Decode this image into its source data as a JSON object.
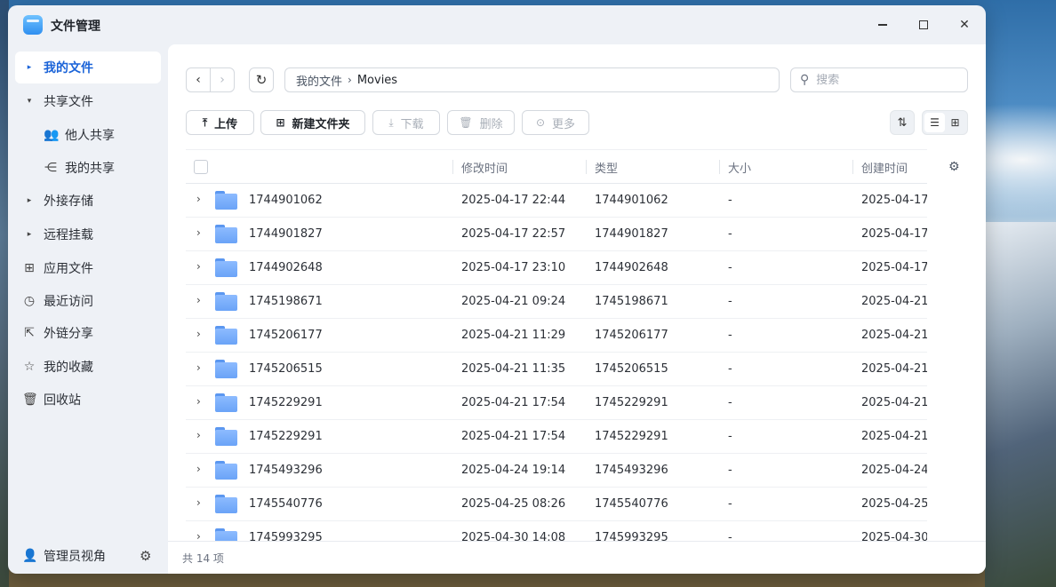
{
  "app": {
    "title": "文件管理"
  },
  "sidebar": {
    "items": [
      {
        "label": "我的文件",
        "caret": "▸",
        "active": true
      },
      {
        "label": "共享文件",
        "caret": "▾"
      },
      {
        "label": "他人共享",
        "icon": "users-icon"
      },
      {
        "label": "我的共享",
        "icon": "share-icon"
      },
      {
        "label": "外接存储",
        "caret": "▸"
      },
      {
        "label": "远程挂载",
        "caret": "▸"
      },
      {
        "label": "应用文件",
        "icon": "apps-icon"
      },
      {
        "label": "最近访问",
        "icon": "clock-icon"
      },
      {
        "label": "外链分享",
        "icon": "external-share-icon"
      },
      {
        "label": "我的收藏",
        "icon": "star-icon"
      },
      {
        "label": "回收站",
        "icon": "trash-icon"
      }
    ],
    "footer": {
      "label": "管理员视角",
      "icon": "admin-user-icon",
      "settings_icon": "gear-icon"
    }
  },
  "breadcrumb": {
    "root": "我的文件",
    "separator": "›",
    "current": "Movies"
  },
  "search": {
    "placeholder": "搜索"
  },
  "toolbar": {
    "upload": "上传",
    "new_folder": "新建文件夹",
    "download": "下载",
    "delete": "删除",
    "more": "更多"
  },
  "table": {
    "columns": {
      "modified": "修改时间",
      "type": "类型",
      "size": "大小",
      "created": "创建时间"
    },
    "rows": [
      {
        "name": "1744901062",
        "modified": "2025-04-17 22:44",
        "type": "1744901062",
        "size": "-",
        "created": "2025-04-17"
      },
      {
        "name": "1744901827",
        "modified": "2025-04-17 22:57",
        "type": "1744901827",
        "size": "-",
        "created": "2025-04-17"
      },
      {
        "name": "1744902648",
        "modified": "2025-04-17 23:10",
        "type": "1744902648",
        "size": "-",
        "created": "2025-04-17"
      },
      {
        "name": "1745198671",
        "modified": "2025-04-21 09:24",
        "type": "1745198671",
        "size": "-",
        "created": "2025-04-21"
      },
      {
        "name": "1745206177",
        "modified": "2025-04-21 11:29",
        "type": "1745206177",
        "size": "-",
        "created": "2025-04-21"
      },
      {
        "name": "1745206515",
        "modified": "2025-04-21 11:35",
        "type": "1745206515",
        "size": "-",
        "created": "2025-04-21"
      },
      {
        "name": "1745229291",
        "modified": "2025-04-21 17:54",
        "type": "1745229291",
        "size": "-",
        "created": "2025-04-21"
      },
      {
        "name": "1745229291",
        "modified": "2025-04-21 17:54",
        "type": "1745229291",
        "size": "-",
        "created": "2025-04-21"
      },
      {
        "name": "1745493296",
        "modified": "2025-04-24 19:14",
        "type": "1745493296",
        "size": "-",
        "created": "2025-04-24"
      },
      {
        "name": "1745540776",
        "modified": "2025-04-25 08:26",
        "type": "1745540776",
        "size": "-",
        "created": "2025-04-25"
      },
      {
        "name": "1745993295",
        "modified": "2025-04-30 14:08",
        "type": "1745993295",
        "size": "-",
        "created": "2025-04-30"
      }
    ]
  },
  "status": {
    "count_text": "共 14 项"
  },
  "colors": {
    "accent": "#1a63d8",
    "folder": "#6aa3f7"
  }
}
